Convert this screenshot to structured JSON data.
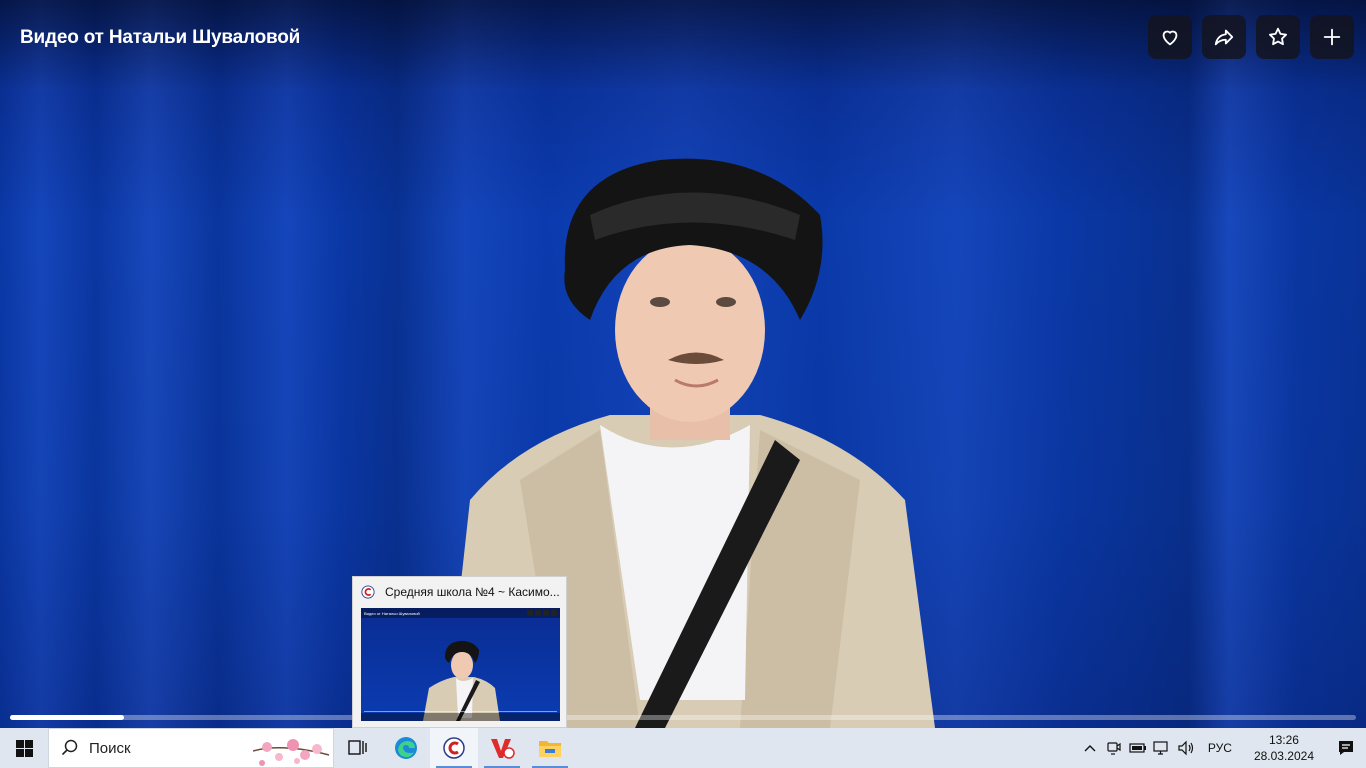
{
  "video": {
    "title": "Видео от Натальи Шуваловой",
    "progress": 0.085
  },
  "actions": [
    {
      "name": "like-button",
      "icon": "heart-icon"
    },
    {
      "name": "share-button",
      "icon": "share-icon"
    },
    {
      "name": "favorite-button",
      "icon": "star-icon"
    },
    {
      "name": "add-button",
      "icon": "plus-icon"
    }
  ],
  "preview": {
    "title": "Средняя школа №4 ~ Касимо...",
    "thumb_title": "Видео от Натальи Шуваловой"
  },
  "taskbar": {
    "search_label": "Поиск",
    "lang": "РУС",
    "time": "13:26",
    "date": "28.03.2024",
    "apps": [
      "task-view-icon",
      "edge-icon",
      "browser-c-icon",
      "wps-office-icon",
      "file-explorer-icon"
    ]
  },
  "colors": {
    "curtain": "#0b3cb2",
    "taskbar": "#dfe6ef",
    "accent": "#5a8dd6"
  }
}
